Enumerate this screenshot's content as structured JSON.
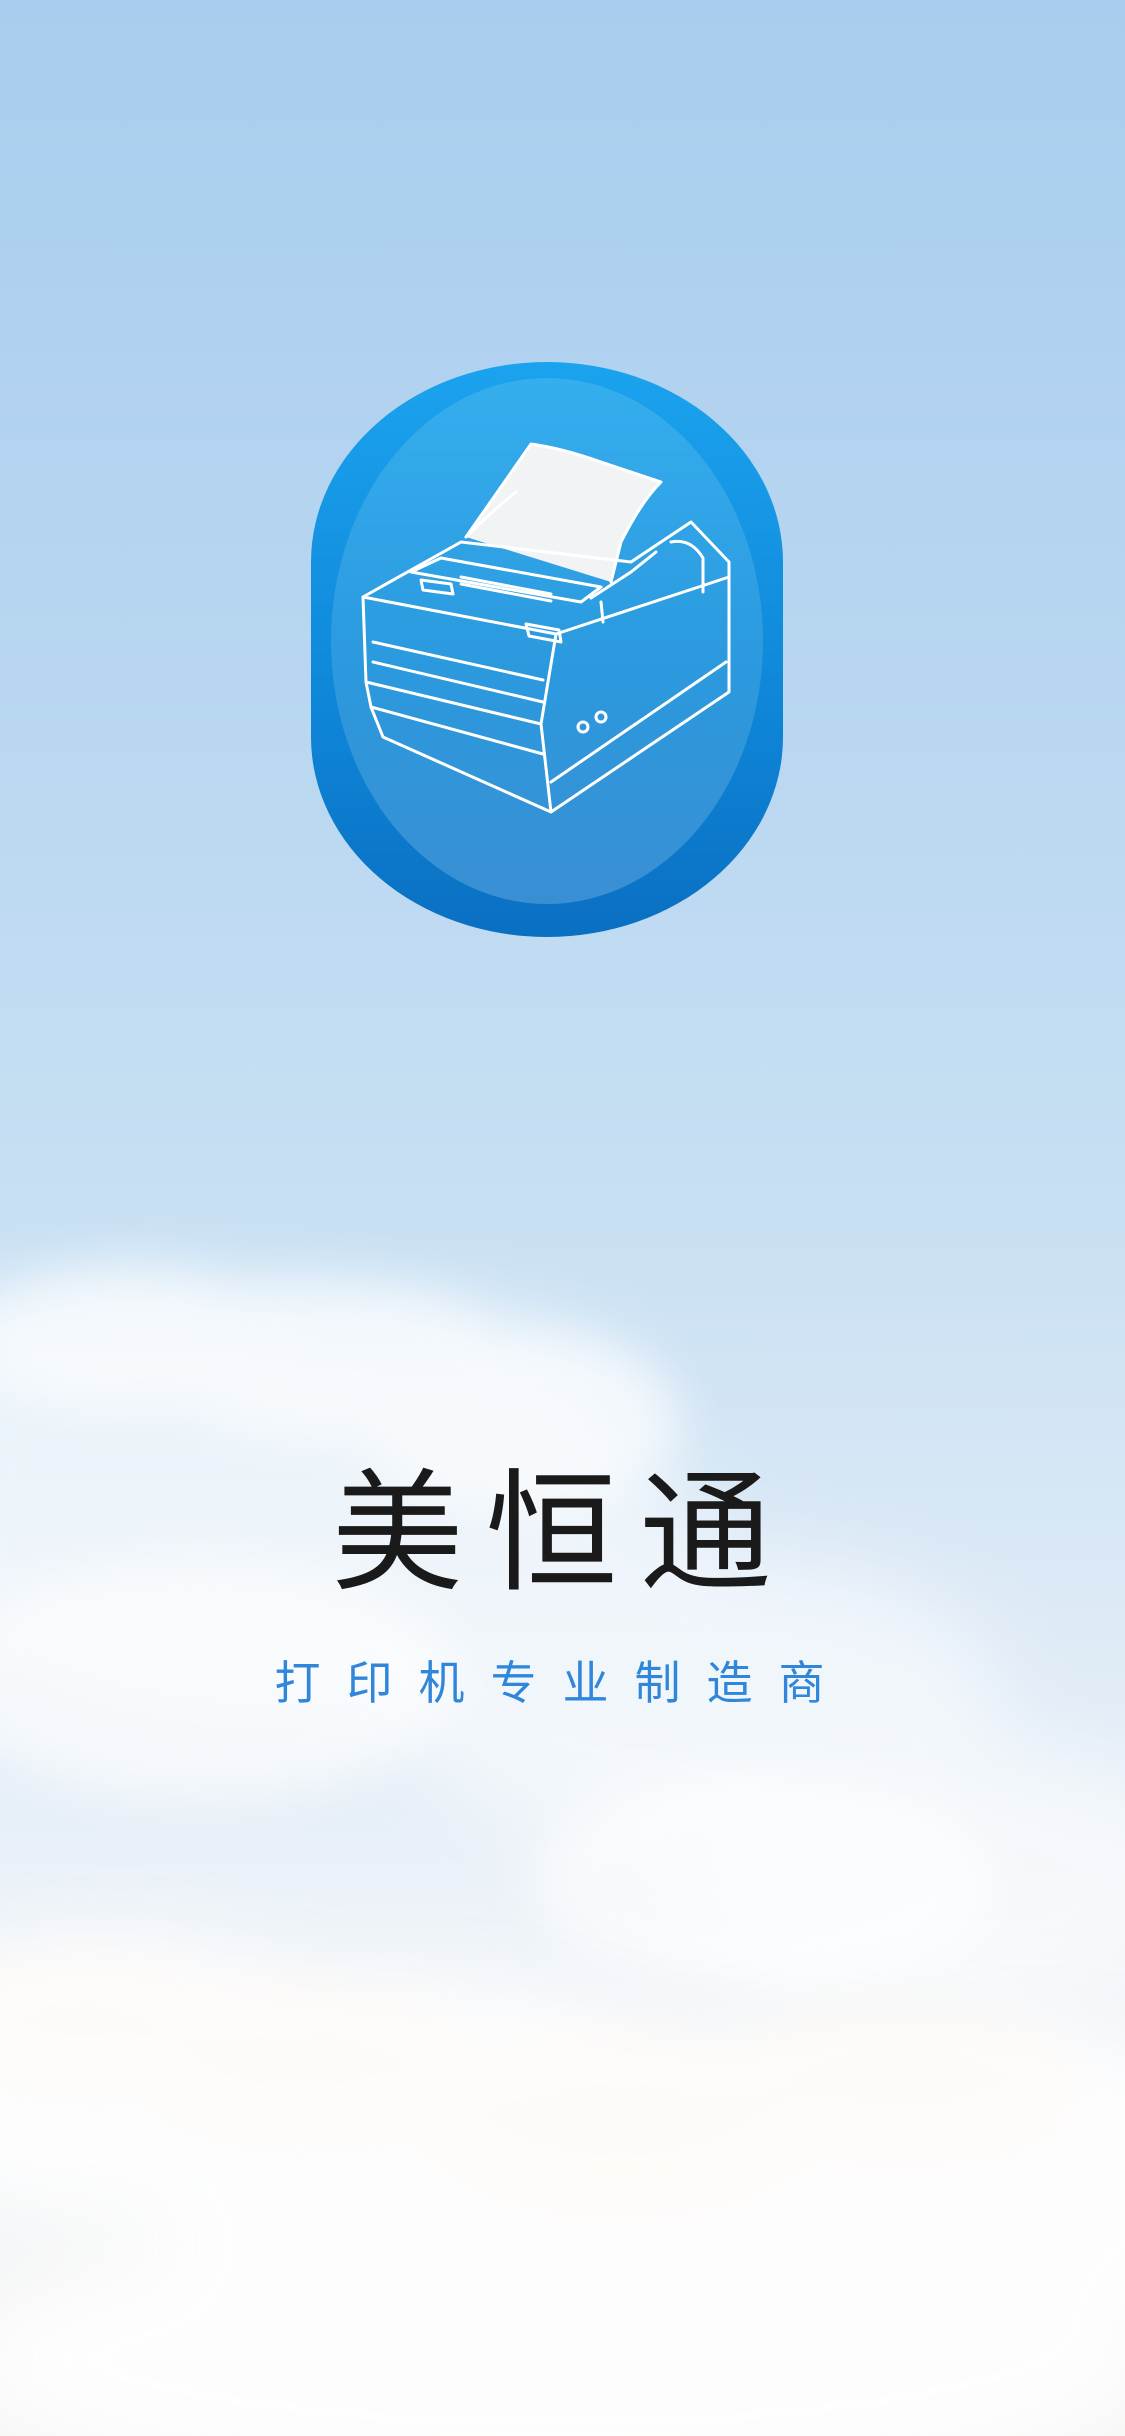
{
  "splash": {
    "app_icon": "thermal-printer-icon",
    "brand_name": "美恒通",
    "tagline": "打印机专业制造商"
  },
  "colors": {
    "icon_blue": "#1186d9",
    "tagline_blue": "#2f86db",
    "brand_text": "#1a1a1a"
  }
}
